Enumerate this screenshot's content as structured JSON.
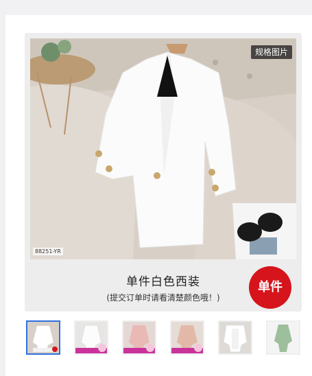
{
  "main": {
    "spec_badge": "规格图片",
    "sku": "88251-YR",
    "title": "单件白色西装",
    "subtitle": "(提交订单时请看清楚颜色哦！)",
    "badge": "单件"
  },
  "thumbnails": [
    {
      "name": "white-single",
      "selected": true
    },
    {
      "name": "white-variant"
    },
    {
      "name": "pink-variant"
    },
    {
      "name": "beige-pink-variant"
    },
    {
      "name": "white-set-variant"
    },
    {
      "name": "green-variant"
    }
  ],
  "colors": {
    "accent_red": "#d6141c",
    "selected_border": "#2f6fe0"
  }
}
